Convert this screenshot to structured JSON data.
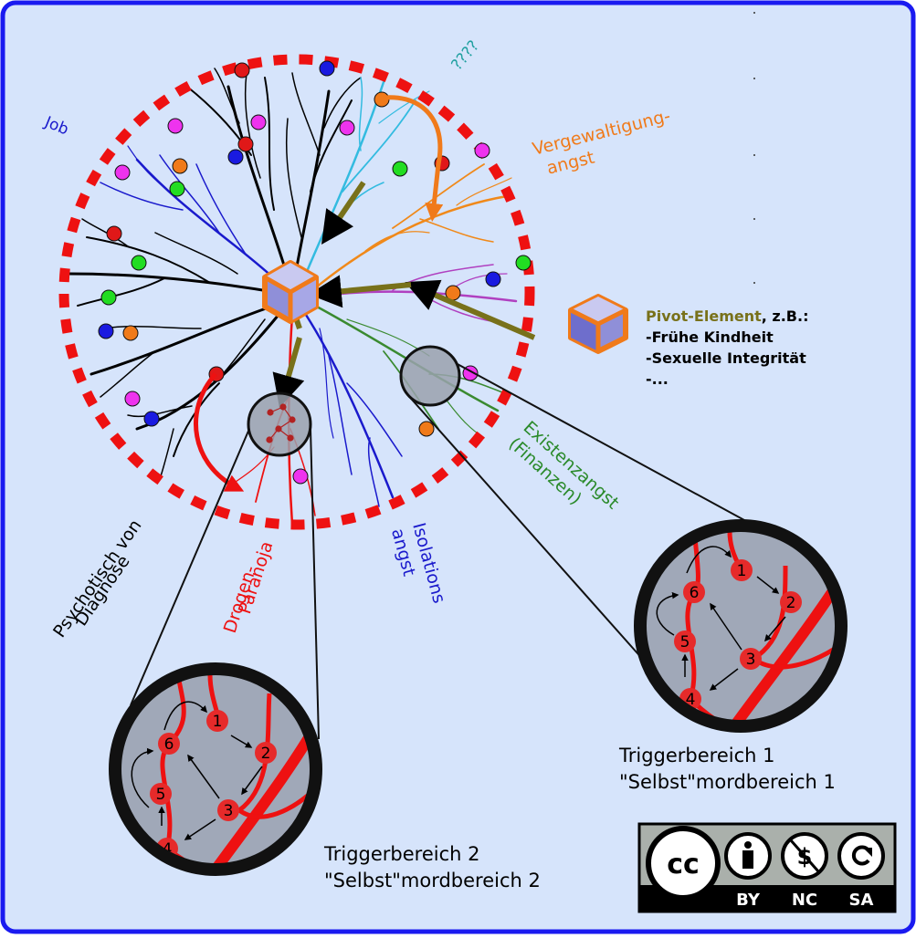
{
  "labels": {
    "job": "Job",
    "question": "????",
    "rape_1": "Vergewaltigung-",
    "rape_2": "angst",
    "existence_1": "Existenzangst",
    "existence_2": "(Finanzen)",
    "isolation_1": "Isolations",
    "isolation_2": "angst",
    "drug_1": "Drogen-",
    "drug_2": "Paranoja",
    "psych_1": "Psychotisch von",
    "psych_2": "Diagnose"
  },
  "legend": {
    "pivot_title": "Pivot-Element",
    "pivot_suffix": ", z.B.:",
    "items": [
      "-Frühe Kindheit",
      "-Sexuelle Integrität",
      "-..."
    ]
  },
  "zoom1": {
    "nodes": [
      "1",
      "2",
      "3",
      "4",
      "5",
      "6"
    ],
    "caption_1": "Triggerbereich 1",
    "caption_2": "\"Selbst\"mordbereich 1"
  },
  "zoom2": {
    "nodes": [
      "1",
      "2",
      "3",
      "4",
      "5",
      "6"
    ],
    "caption_1": "Triggerbereich 2",
    "caption_2": "\"Selbst\"mordbereich 2"
  },
  "license": {
    "cc": "cc",
    "by": "BY",
    "nc": "NC",
    "sa": "SA"
  },
  "colors": {
    "background": "#d6e4fb",
    "frame": "#1a1af0",
    "dashed_circle": "#ee1111",
    "pivot": "#f07a1a",
    "olive_arrow": "#78711a",
    "zoom_fill": "#a0a8b8",
    "node_red": "#e62a2a"
  }
}
